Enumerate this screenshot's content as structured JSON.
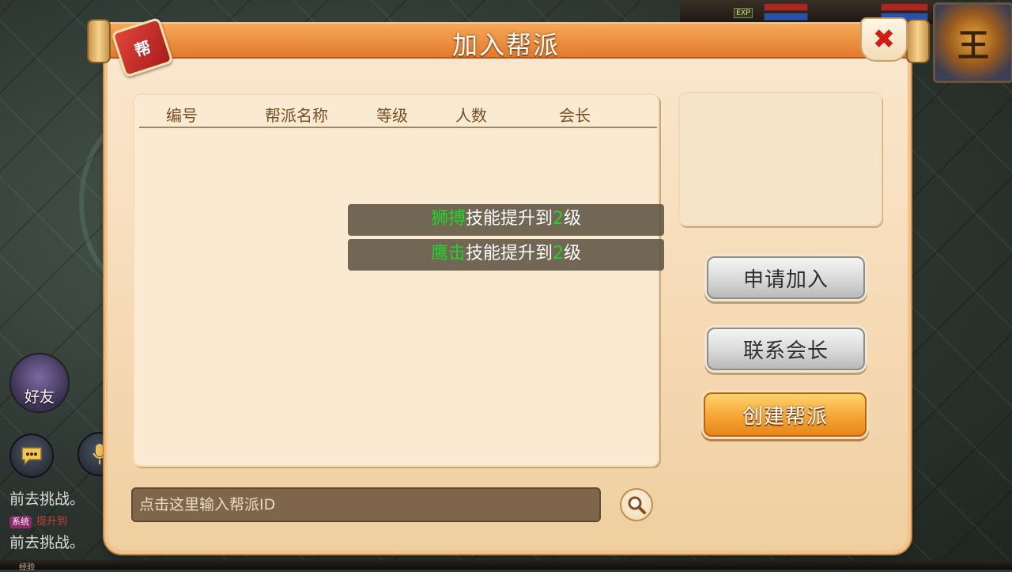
{
  "dialog": {
    "title": "加入帮派",
    "seal_label": "帮",
    "close_label": "✖"
  },
  "table": {
    "headers": {
      "id": "编号",
      "name": "帮派名称",
      "level": "等级",
      "count": "人数",
      "leader": "会长"
    },
    "rows": []
  },
  "buttons": {
    "apply": "申请加入",
    "contact": "联系会长",
    "create": "创建帮派"
  },
  "search": {
    "placeholder": "点击这里输入帮派ID"
  },
  "toasts": [
    {
      "skill": "狮搏",
      "middle": "技能提升到",
      "level": "2",
      "suffix": "级"
    },
    {
      "skill": "鹰击",
      "middle": "技能提升到",
      "level": "2",
      "suffix": "级"
    }
  ],
  "hud": {
    "exp_tag": "EXP",
    "portrait_glyph": "王",
    "friend_label": "好友",
    "chat_lines": [
      "前去挑战。",
      "前去挑战。"
    ],
    "system_tag": "系统",
    "system_rest": "提升到",
    "exp_bottom_label": "经验"
  },
  "colors": {
    "title_orange": "#e27a2c",
    "skill_green": "#22d42a",
    "create_orange": "#f6a533",
    "close_red": "#d21b15"
  },
  "icons": {
    "search": "magnifier-icon",
    "close": "close-x-icon",
    "seal": "guild-seal-icon",
    "chat": "chat-bubble-icon",
    "voice": "microphone-icon"
  }
}
